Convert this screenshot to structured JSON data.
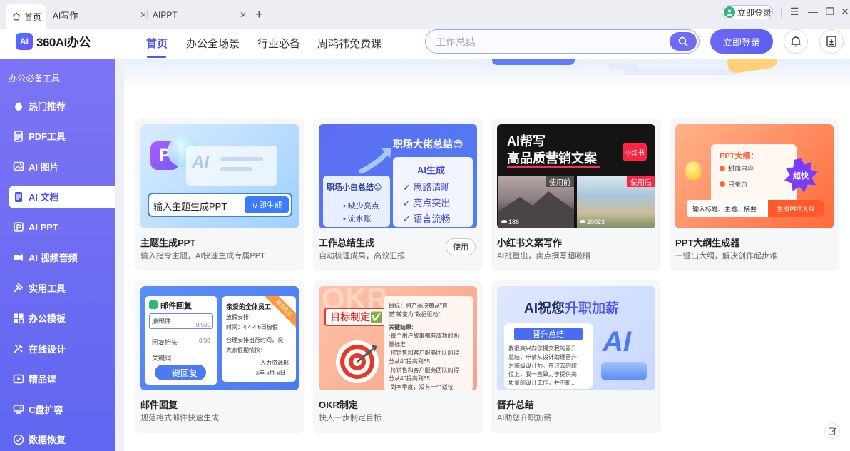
{
  "tabs": [
    {
      "label": "首页",
      "active": true
    },
    {
      "label": "AI写作",
      "active": false
    },
    {
      "label": "AIPPT",
      "active": false
    }
  ],
  "window": {
    "login_label": "立即登录"
  },
  "header": {
    "logo_badge": "AI",
    "logo_text": "360AI办公",
    "nav": [
      "首页",
      "办公全场景",
      "行业必备",
      "周鸿祎免费课"
    ],
    "search_placeholder": "工作总结",
    "login_label": "立即登录"
  },
  "sidebar": {
    "title": "办公必备工具",
    "items": [
      {
        "label": "热门推荐",
        "icon": "flame-icon"
      },
      {
        "label": "PDF工具",
        "icon": "pdf-icon"
      },
      {
        "label": "AI 图片",
        "icon": "image-icon"
      },
      {
        "label": "AI 文档",
        "icon": "document-icon",
        "active": true
      },
      {
        "label": "AI PPT",
        "icon": "ppt-icon"
      },
      {
        "label": "AI 视频音频",
        "icon": "video-icon"
      },
      {
        "label": "实用工具",
        "icon": "tools-icon"
      },
      {
        "label": "办公模板",
        "icon": "template-icon"
      },
      {
        "label": "在线设计",
        "icon": "design-icon"
      },
      {
        "label": "精品课",
        "icon": "course-icon"
      },
      {
        "label": "C盘扩容",
        "icon": "disk-icon"
      },
      {
        "label": "数据恢复",
        "icon": "recover-icon"
      }
    ]
  },
  "cards": [
    {
      "title": "主题生成PPT",
      "desc": "输入指令主题，AI快速生成专属PPT",
      "thumb": {
        "input_text": "输入主题生成PPT",
        "button": "立即生成"
      }
    },
    {
      "title": "工作总结生成",
      "desc": "自动梳理成果，高效汇报",
      "use_label": "使用",
      "thumb": {
        "heading": "职场大佬总结😎",
        "left_title": "职场小白总结😟",
        "left_items": [
          "• 缺少亮点",
          "• 流水账"
        ],
        "right_title": "AI生成",
        "right_items": [
          "✓ 思路清晰",
          "✓ 亮点突出",
          "✓ 语言流畅"
        ]
      }
    },
    {
      "title": "小红书文案写作",
      "desc": "AI批量出，卖点撰写超吸睛",
      "thumb": {
        "line1": "AI帮写",
        "line2": "高品质营销文案",
        "badge": "小红书",
        "before": "使用前",
        "after": "使用后",
        "views1": "186",
        "views2": "20023"
      }
    },
    {
      "title": "PPT大纲生成器",
      "desc": "一键出大纲，解决创作起步难",
      "thumb": {
        "doc_title": "PPT大纲：",
        "item1": "封面内容",
        "item2": "目录页",
        "star": "超快",
        "input": "输入标题、主题、摘要",
        "button": "生成PPT大纲"
      }
    },
    {
      "title": "邮件回复",
      "desc": "规范格式邮件快速生成",
      "thumb": {
        "panel_title": "邮件回复",
        "field1": "原邮件",
        "count1": "0/500",
        "field2": "回复抬头",
        "count2": "0/30",
        "field3": "关键词",
        "button": "一键回复",
        "letter": [
          "亲爱的全体员工:",
          "放假安排:",
          "时间：4.4-4.6日放假",
          "合理安排出行时间，祝",
          "大家假期愉快！",
          "人力资源部",
          "x年-x月-x日"
        ],
        "ribbon": "规范格式"
      }
    },
    {
      "title": "OKR制定",
      "desc": "快人一步制定目标",
      "thumb": {
        "label": "目标制定✅",
        "bg": "OKR",
        "goal": [
          "目标：将产品决策从\"直",
          "觉\"转变为\"数据驱动\""
        ],
        "results_title": "关键结果:",
        "results": [
          "·每个用户故事都有成功的衡",
          "量标准",
          "·将销售和客户服务团队的得",
          "分从40提高到65",
          "·将销售和客户服务团队的得",
          "分从40提高到65",
          "·到本季度，没有一个适位"
        ]
      }
    },
    {
      "title": "晋升总结",
      "desc": "AI助您升职加薪",
      "thumb": {
        "heading_a": "AI祝您",
        "heading_b": "升职加薪",
        "tag": "晋升总结",
        "body": [
          "我很高兴向您提交我的晋升",
          "总结，申请从设计助理晋升",
          "为高级设计师。在过去的职",
          "位上，我一直致力于提供高",
          "质量的设计工作，并不断..."
        ],
        "ai": "AI"
      }
    }
  ]
}
